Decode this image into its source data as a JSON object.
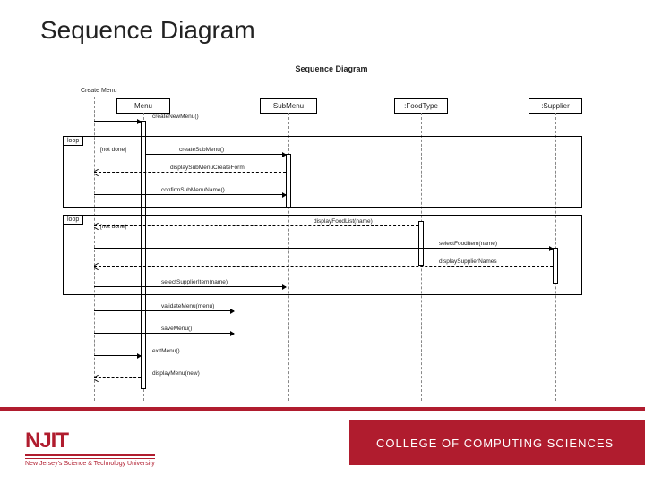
{
  "title": "Sequence Diagram",
  "sd": {
    "caption": "Sequence Diagram",
    "actor": "Create Menu",
    "lifelines": {
      "l1": "Menu",
      "l2": "SubMenu",
      "l3": ":FoodType",
      "l4": ":Supplier"
    },
    "frames": {
      "loop1_label": "loop",
      "loop1_guard": "[not done]",
      "loop2_label": "loop",
      "loop2_guard": "[not done]"
    },
    "messages": {
      "m1": "createNewMenu()",
      "m2": "createSubMenu()",
      "m3": "displaySubMenuCreateForm",
      "m4": "confirmSubMenuName()",
      "m5": "displayFoodList(name)",
      "m6": "selectFoodItem(name)",
      "m7": "displaySupplierNames",
      "m8": "selectSupplierItem(name)",
      "m9": "validateMenu(menu)",
      "m10": "saveMenu()",
      "m11": "exitMenu()",
      "m12": "displayMenu(new)"
    }
  },
  "footer": {
    "logo": "NJIT",
    "tagline": "New Jersey's Science & Technology University",
    "college": "COLLEGE OF COMPUTING SCIENCES"
  }
}
